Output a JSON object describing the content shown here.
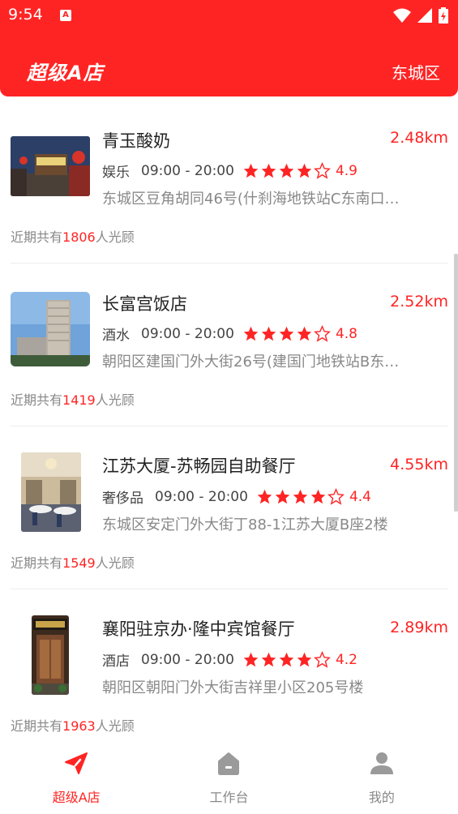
{
  "status_bar": {
    "time": "9:54",
    "notification_icon": "A"
  },
  "header": {
    "title": "超级A店",
    "district": "东城区"
  },
  "colors": {
    "brand": "#ff2424",
    "star": "#ff2424",
    "muted": "#888888"
  },
  "stores": [
    {
      "name": "青玉酸奶",
      "distance": "2.48km",
      "category": "娱乐",
      "hours": "09:00 - 20:00",
      "rating": "4.9",
      "stars": 4,
      "address": "东城区豆角胡同46号(什刹海地铁站C东南口…",
      "visits_prefix": "近期共有",
      "visits_count": "1806",
      "visits_suffix": "人光顾"
    },
    {
      "name": "长富宫饭店",
      "distance": "2.52km",
      "category": "酒水",
      "hours": "09:00 - 20:00",
      "rating": "4.8",
      "stars": 4,
      "address": "朝阳区建国门外大街26号(建国门地铁站B东…",
      "visits_prefix": "近期共有",
      "visits_count": "1419",
      "visits_suffix": "人光顾"
    },
    {
      "name": "江苏大厦-苏畅园自助餐厅",
      "distance": "4.55km",
      "category": "奢侈品",
      "hours": "09:00 - 20:00",
      "rating": "4.4",
      "stars": 4,
      "address": "东城区安定门外大街丁88-1江苏大厦B座2楼",
      "visits_prefix": "近期共有",
      "visits_count": "1549",
      "visits_suffix": "人光顾"
    },
    {
      "name": "襄阳驻京办·隆中宾馆餐厅",
      "distance": "2.89km",
      "category": "酒店",
      "hours": "09:00 - 20:00",
      "rating": "4.2",
      "stars": 4,
      "address": "朝阳区朝阳门外大街吉祥里小区205号楼",
      "visits_prefix": "近期共有",
      "visits_count": "1963",
      "visits_suffix": "人光顾"
    }
  ],
  "tabbar": [
    {
      "label": "超级A店",
      "icon": "send-icon",
      "active": true
    },
    {
      "label": "工作台",
      "icon": "home-icon",
      "active": false
    },
    {
      "label": "我的",
      "icon": "user-icon",
      "active": false
    }
  ]
}
